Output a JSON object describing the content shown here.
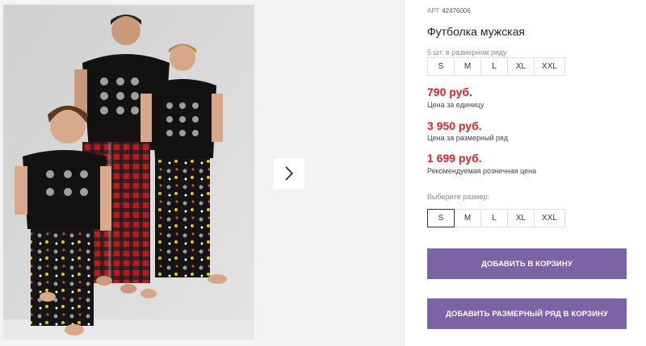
{
  "gallery": {
    "photo_icon": "product-photo-family-pajamas",
    "next_icon": "chevron-right-icon"
  },
  "product": {
    "article_label": "АРТ",
    "article_value": "42476006",
    "title": "Футболка мужская"
  },
  "pack": {
    "note": "5 шт. в размерном ряду",
    "sizes": [
      "S",
      "M",
      "L",
      "XL",
      "XXL"
    ]
  },
  "prices": {
    "unit_price": "790 руб.",
    "unit_label": "Цена за единицу",
    "pack_price": "3 950 руб.",
    "pack_label": "Цена за размерный ряд",
    "retail_price": "1 699 руб.",
    "retail_label": "Рекомендуемая розничная цена"
  },
  "size_select": {
    "label": "Выберите размер:",
    "sizes": [
      "S",
      "M",
      "L",
      "XL",
      "XXL"
    ],
    "selected": "S"
  },
  "buttons": {
    "add_to_cart": "Добавить в корзину",
    "add_pack_to_cart": "Добавить размерный ряд в корзину"
  },
  "colors": {
    "accent": "#7b63a6",
    "price": "#e3202b"
  }
}
